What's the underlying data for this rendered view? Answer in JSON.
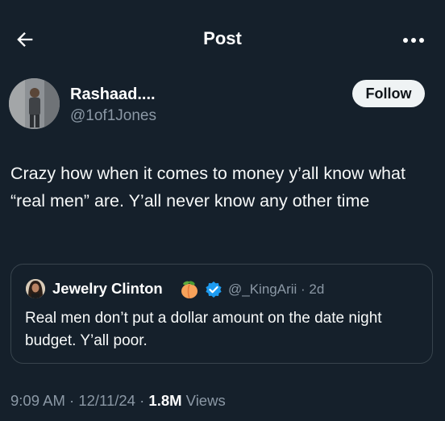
{
  "header": {
    "title": "Post",
    "back_icon": "arrow-left-icon",
    "more_icon": "more-horizontal-icon"
  },
  "post": {
    "author_name": "Rashaad....",
    "author_handle": "@1of1Jones",
    "follow_label": "Follow",
    "text": "Crazy how when it comes to money y’all know what “real men” are. Y’all never know any other time",
    "timestamp": "9:09 AM · 12/11/24 · ",
    "views_count": "1.8M",
    "views_label": " Views"
  },
  "quoted_post": {
    "author_name": "Jewelry Clinton",
    "emoji_icon": "peach-emoji-icon",
    "verified_icon": "verified-badge-icon",
    "handle": "@_KingArii",
    "age": " · 2d",
    "text": "Real men don’t put a dollar amount on the date night budget. Y’all poor."
  },
  "colors": {
    "background": "#15202b",
    "text_primary": "#f7f9f9",
    "text_secondary": "#8b98a5",
    "border": "#38444d",
    "verified": "#1d9bf0"
  }
}
